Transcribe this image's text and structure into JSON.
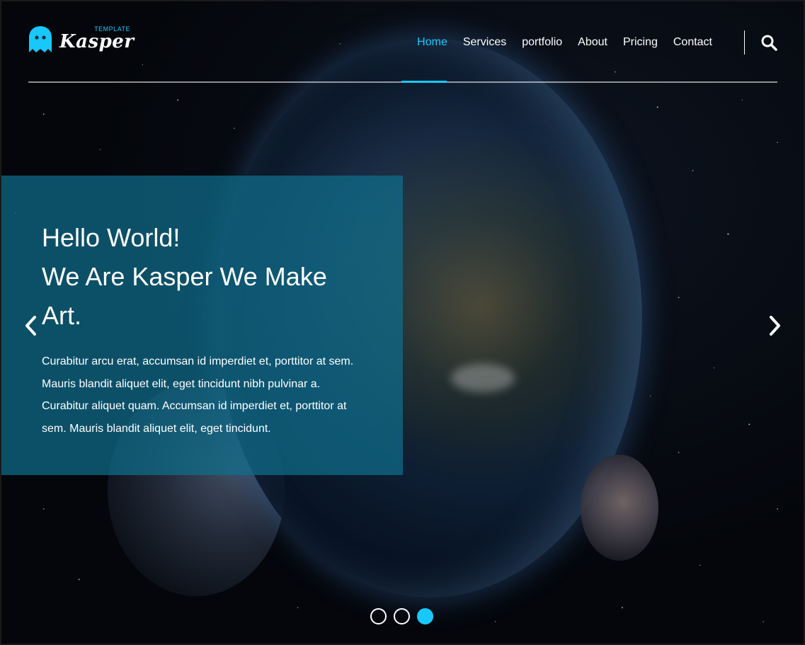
{
  "logo": {
    "word": "Kasper",
    "tag": "TEMPLATE",
    "icon": "ghost-icon"
  },
  "nav": {
    "items": [
      {
        "label": "Home",
        "active": true
      },
      {
        "label": "Services",
        "active": false
      },
      {
        "label": "portfolio",
        "active": false
      },
      {
        "label": "About",
        "active": false
      },
      {
        "label": "Pricing",
        "active": false
      },
      {
        "label": "Contact",
        "active": false
      }
    ],
    "search_icon": "search-icon"
  },
  "hero": {
    "title_line1": "Hello World!",
    "title_line2": "We Are Kasper We Make Art.",
    "text": "Curabitur arcu erat, accumsan id imperdiet et, porttitor at sem. Mauris blandit aliquet elit, eget tincidunt nibh pulvinar a. Curabitur aliquet quam. Accumsan id imperdiet et, porttitor at sem. Mauris blandit aliquet elit, eget tincidunt."
  },
  "slider": {
    "prev_icon": "chevron-left-icon",
    "next_icon": "chevron-right-icon",
    "slide_count": 3,
    "active_slide": 3
  },
  "colors": {
    "accent": "#19c8fa",
    "panel": "#0f6e8c"
  }
}
